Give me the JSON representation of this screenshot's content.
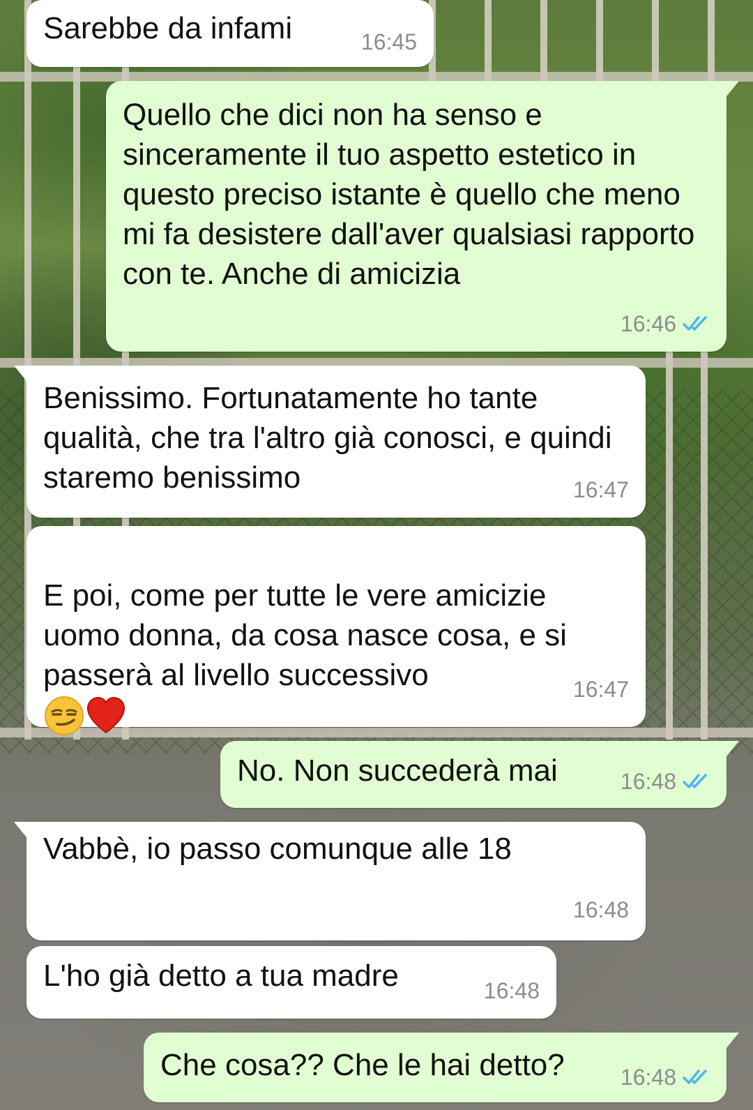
{
  "colors": {
    "incoming_bubble": "#ffffff",
    "outgoing_bubble": "#e1fdd2",
    "timestamp": "#8c8c8c",
    "read_ticks": "#4fb6ec"
  },
  "icons": {
    "read_receipt": "double-check-icon",
    "emoji_smirk": "smirking-face-emoji",
    "emoji_heart": "red-heart-emoji"
  },
  "messages": [
    {
      "direction": "in",
      "text": "Sarebbe da infami",
      "time": "16:45"
    },
    {
      "direction": "out",
      "text": "Quello che dici non ha senso e sinceramente il tuo aspetto estetico in questo preciso istante è quello che meno mi fa desistere dall'aver qualsiasi rapporto con te. Anche di amicizia",
      "time": "16:46",
      "status": "read"
    },
    {
      "direction": "in",
      "text": "Benissimo. Fortunatamente ho tante qualità, che tra l'altro già conosci, e quindi staremo benissimo",
      "time": "16:47"
    },
    {
      "direction": "in",
      "text": "E poi, come per tutte le vere amicizie uomo donna, da cosa nasce cosa, e si passerà al livello successivo",
      "time": "16:47",
      "emojis": [
        "smirking-face",
        "red-heart"
      ]
    },
    {
      "direction": "out",
      "text": "No. Non succederà mai",
      "time": "16:48",
      "status": "read"
    },
    {
      "direction": "in",
      "text": "Vabbè, io passo comunque alle 18",
      "time": "16:48"
    },
    {
      "direction": "in",
      "text": "L'ho già detto a tua madre",
      "time": "16:48"
    },
    {
      "direction": "out",
      "text": "Che cosa?? Che le hai detto?",
      "time": "16:48",
      "status": "read"
    }
  ]
}
